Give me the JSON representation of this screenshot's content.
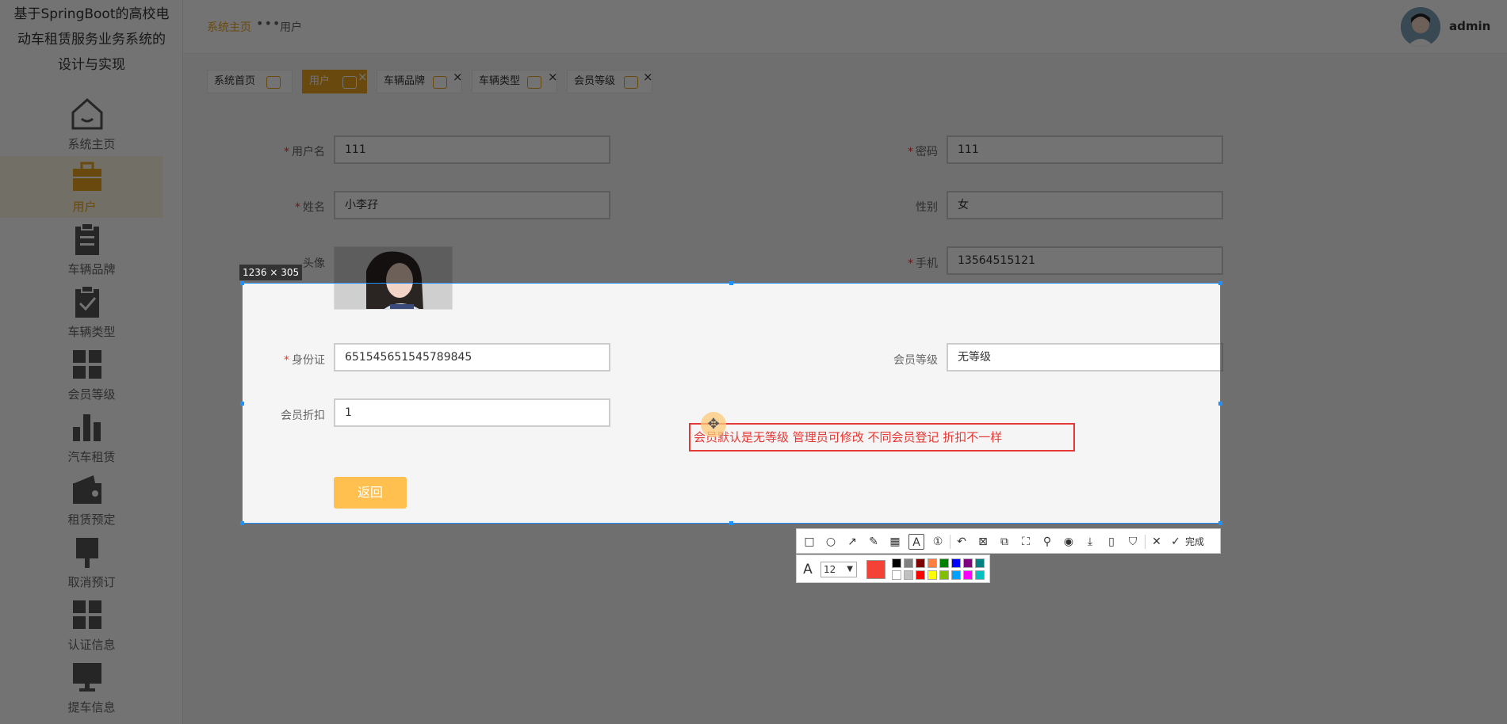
{
  "app": {
    "title": "基于SpringBoot的高校电动车租赁服务业务系统的设计与实现"
  },
  "sidebar": {
    "title_lines": [
      "基于SpringBoot的高校电",
      "动车租赁服务业务系统的",
      "设计与实现"
    ],
    "items": [
      {
        "label": "系统主页",
        "icon": "home-icon"
      },
      {
        "label": "用户",
        "icon": "briefcase-icon",
        "active": true
      },
      {
        "label": "车辆品牌",
        "icon": "clipboard-icon"
      },
      {
        "label": "车辆类型",
        "icon": "clipboard-check-icon"
      },
      {
        "label": "会员等级",
        "icon": "grid-icon"
      },
      {
        "label": "汽车租赁",
        "icon": "bar-chart-icon"
      },
      {
        "label": "租赁预定",
        "icon": "wallet-icon"
      },
      {
        "label": "取消预订",
        "icon": "brush-icon"
      },
      {
        "label": "认证信息",
        "icon": "grid-icon"
      },
      {
        "label": "提车信息",
        "icon": "monitor-icon"
      }
    ]
  },
  "header": {
    "breadcrumb_home": "系统主页",
    "breadcrumb_dots": "•••",
    "breadcrumb_current": "用户",
    "username": "admin"
  },
  "tabs": [
    {
      "label": "系统首页",
      "closable": false
    },
    {
      "label": "用户",
      "closable": true,
      "active": true
    },
    {
      "label": "车辆品牌",
      "closable": true
    },
    {
      "label": "车辆类型",
      "closable": true
    },
    {
      "label": "会员等级",
      "closable": true
    }
  ],
  "form": {
    "username": {
      "label": "用户名",
      "value": "111",
      "required": true
    },
    "password": {
      "label": "密码",
      "value": "111",
      "required": true
    },
    "name": {
      "label": "姓名",
      "value": "小李孖",
      "required": true
    },
    "gender": {
      "label": "性别",
      "value": "女"
    },
    "avatar": {
      "label": "头像"
    },
    "phone": {
      "label": "手机",
      "value": "13564515121",
      "required": true
    },
    "id_card": {
      "label": "身份证",
      "value": "651545651545789845",
      "required": true
    },
    "member_level": {
      "label": "会员等级",
      "value": "无等级"
    },
    "member_discount": {
      "label": "会员折扣",
      "value": "1"
    },
    "back_button": "返回"
  },
  "screenshot_tool": {
    "size_label": "1236 × 305",
    "annotation_text": "会员默认是无等级  管理员可修改  不同会员登记 折扣不一样",
    "done_label": "完成",
    "font_size": "12",
    "current_color": "#f44336",
    "palette": [
      "#000000",
      "#808080",
      "#800000",
      "#ff8040",
      "#008000",
      "#0000ff",
      "#800080",
      "#008080",
      "#ffffff",
      "#c0c0c0",
      "#ff0000",
      "#ffff00",
      "#80c000",
      "#00a0ff",
      "#ff00ff",
      "#00c0c0"
    ]
  },
  "colors": {
    "accent": "#e9a21f",
    "selection": "#1e90ff",
    "annotation": "#e53935"
  }
}
